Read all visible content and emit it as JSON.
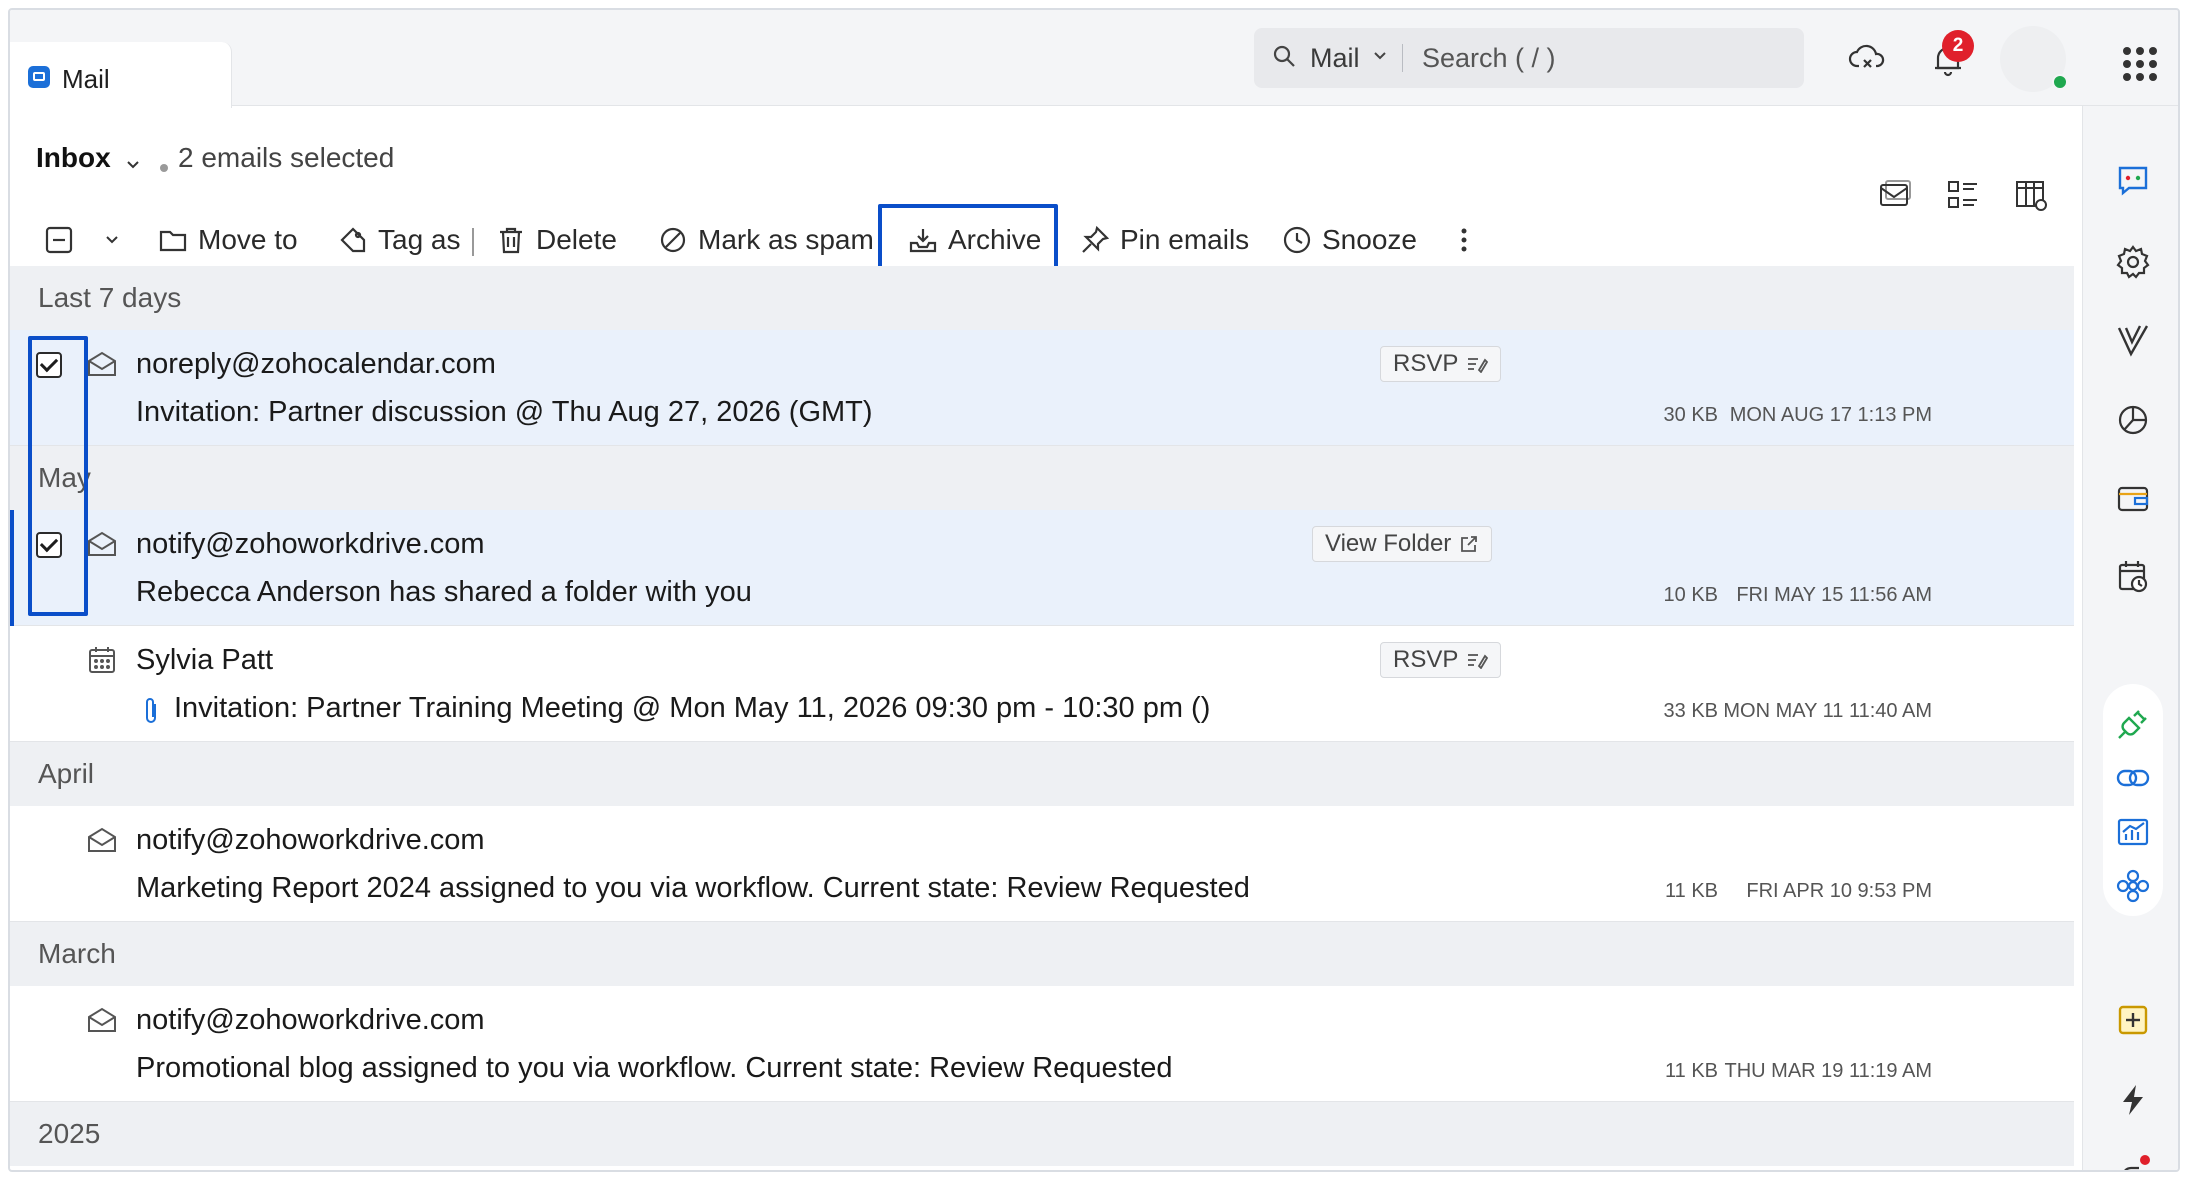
{
  "tab": {
    "label": "Mail"
  },
  "search": {
    "scope": "Mail",
    "placeholder": "Search ( / )"
  },
  "notifications": {
    "count": "2"
  },
  "header": {
    "folder": "Inbox",
    "selection": "2 emails selected"
  },
  "toolbar": {
    "move_to": "Move to",
    "tag_as": "Tag as",
    "delete": "Delete",
    "mark_as_spam": "Mark as spam",
    "archive": "Archive",
    "pin_emails": "Pin emails",
    "snooze": "Snooze"
  },
  "groups": {
    "last7": "Last 7 days",
    "may": "May",
    "april": "April",
    "march": "March",
    "y2025": "2025"
  },
  "emails": [
    {
      "sender": "noreply@zohocalendar.com",
      "subject": "Invitation: Partner discussion @ Thu Aug 27, 2026 (GMT)",
      "size": "30 KB",
      "date": "MON AUG 17 1:13 PM",
      "action": "RSVP",
      "selected": true
    },
    {
      "sender": "notify@zohoworkdrive.com",
      "subject": "Rebecca Anderson has shared a folder with you",
      "size": "10 KB",
      "date": "FRI MAY 15 11:56 AM",
      "action": "View Folder",
      "selected": true
    },
    {
      "sender": "Sylvia Patt",
      "subject": "Invitation: Partner Training Meeting @ Mon May 11, 2026 09:30 pm - 10:30 pm ()",
      "size": "33 KB",
      "date": "MON MAY 11 11:40 AM",
      "action": "RSVP",
      "selected": false
    },
    {
      "sender": "notify@zohoworkdrive.com",
      "subject": "Marketing Report 2024 assigned to you via workflow. Current state: Review Requested",
      "size": "11 KB",
      "date": "FRI APR 10 9:53 PM",
      "action": "",
      "selected": false
    },
    {
      "sender": "notify@zohoworkdrive.com",
      "subject": "Promotional blog assigned to you via workflow. Current state: Review Requested",
      "size": "11 KB",
      "date": "THU MAR 19 11:19 AM",
      "action": "",
      "selected": false
    }
  ],
  "colors": {
    "accent": "#0a4ec9",
    "selected_row": "#eaf1fb",
    "badge": "#e0202b",
    "presence": "#1fa84f"
  }
}
